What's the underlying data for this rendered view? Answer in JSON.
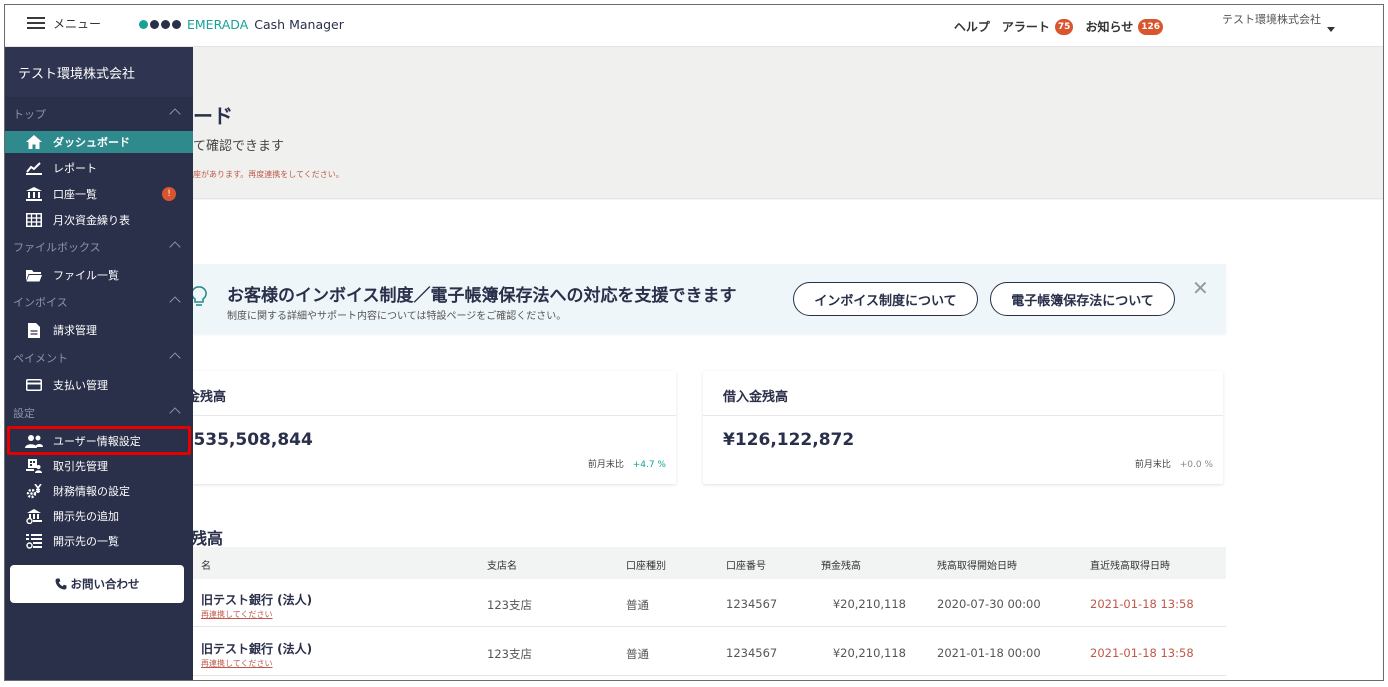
{
  "header": {
    "menu_label": "メニュー",
    "brand_prefix": "EMERADA",
    "brand_suffix": "Cash Manager",
    "help": "ヘルプ",
    "alert": "アラート",
    "alert_count": "75",
    "notice": "お知らせ",
    "notice_count": "126",
    "company": "テスト環境株式会社"
  },
  "page": {
    "title": "ード",
    "subtitle": "て確認できます",
    "warning": "座があります。再度連携をしてください。"
  },
  "banner": {
    "title": "お客様のインボイス制度／電子帳簿保存法への対応を支援できます",
    "description": "制度に関する詳細やサポート内容については特設ページをご確認ください。",
    "button1": "インボイス制度について",
    "button2": "電子帳簿保存法について",
    "close": "✕"
  },
  "cards": [
    {
      "title": "金残高",
      "amount": ",535,508,844",
      "compare_label": "前月末比",
      "compare_value": "+4.7 %"
    },
    {
      "title": "借入金残高",
      "amount": "¥126,122,872",
      "compare_label": "前月末比",
      "compare_value": "+0.0 %"
    }
  ],
  "table": {
    "title": "残高",
    "headers": [
      "名",
      "支店名",
      "口座種別",
      "口座番号",
      "預金残高",
      "残高取得開始日時",
      "直近残高取得日時"
    ],
    "rows": [
      {
        "bank": "旧テスト銀行 (法人)",
        "reauth": "再連携してください",
        "branch": "123支店",
        "type": "普通",
        "number": "1234567",
        "balance": "¥20,210,118",
        "start": "2020-07-30 00:00",
        "latest": "2021-01-18 13:58"
      },
      {
        "bank": "旧テスト銀行 (法人)",
        "reauth": "再連携してください",
        "branch": "123支店",
        "type": "普通",
        "number": "1234567",
        "balance": "¥20,210,118",
        "start": "2021-01-18 00:00",
        "latest": "2021-01-18 13:58"
      }
    ]
  },
  "sidebar": {
    "company": "テスト環境株式会社",
    "sections": [
      "トップ",
      "ファイルボックス",
      "インボイス",
      "ペイメント",
      "設定"
    ],
    "items": [
      {
        "label": "ダッシュボード",
        "icon": "home-icon"
      },
      {
        "label": "レポート",
        "icon": "chart-icon"
      },
      {
        "label": "口座一覧",
        "icon": "bank-icon",
        "badge": "!"
      },
      {
        "label": "月次資金繰り表",
        "icon": "table-icon"
      },
      {
        "label": "ファイル一覧",
        "icon": "folder-icon"
      },
      {
        "label": "請求管理",
        "icon": "document-icon"
      },
      {
        "label": "支払い管理",
        "icon": "card-icon"
      },
      {
        "label": "ユーザー情報設定",
        "icon": "users-icon"
      },
      {
        "label": "取引先管理",
        "icon": "partner-icon"
      },
      {
        "label": "財務情報の設定",
        "icon": "finance-settings-icon"
      },
      {
        "label": "開示先の追加",
        "icon": "add-disclosure-icon"
      },
      {
        "label": "開示先の一覧",
        "icon": "disclosure-list-icon"
      }
    ],
    "contact": "お問い合わせ"
  },
  "colors": {
    "sidebar": "#2a2f4a",
    "active": "#2e8a8c",
    "brand": "#17a197",
    "alert": "#d9552e",
    "highlight": "#e60000"
  }
}
